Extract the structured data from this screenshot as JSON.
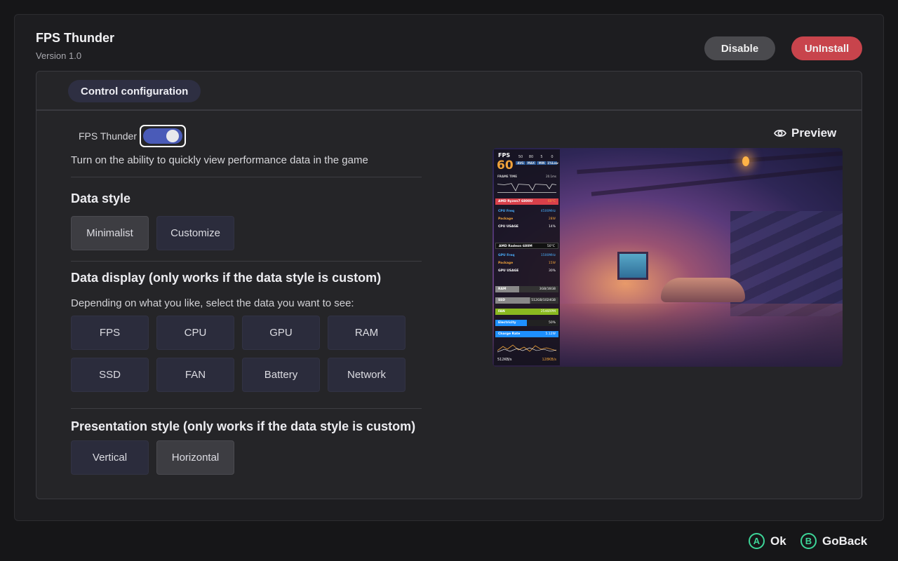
{
  "app": {
    "title": "FPS Thunder",
    "version": "Version 1.0"
  },
  "actions": {
    "disable_label": "Disable",
    "uninstall_label": "UnInstall"
  },
  "tabs": {
    "active_label": "Control configuration"
  },
  "toggle": {
    "label": "FPS Thunder",
    "enabled": true,
    "description": "Turn on the ability to quickly view performance data in the game"
  },
  "data_style": {
    "title": "Data style",
    "options": [
      "Minimalist",
      "Customize"
    ],
    "selected": "Minimalist"
  },
  "data_display": {
    "title": "Data display (only works if the data style is custom)",
    "description": "Depending on what you like, select the data you want to see:",
    "options": [
      "FPS",
      "CPU",
      "GPU",
      "RAM",
      "SSD",
      "FAN",
      "Battery",
      "Network"
    ]
  },
  "presentation_style": {
    "title": "Presentation style (only works if the data style is custom)",
    "options": [
      "Vertical",
      "Horizontal"
    ],
    "selected": "Horizontal"
  },
  "preview": {
    "label": "Preview",
    "hud": {
      "fps_label": "FPS",
      "fps_value": "60",
      "mini_stats": [
        {
          "value": "50",
          "label": "AVG"
        },
        {
          "value": "80",
          "label": "MAX"
        },
        {
          "value": "5",
          "label": "MIN"
        },
        {
          "value": "0",
          "label": "1%Low"
        }
      ],
      "frame_time_label": "FRAME TIME",
      "frame_time_value": "20.1ms",
      "cpu_header": "AMD Ryzen7 6800U",
      "cpu_temp": "60°C",
      "cpu_rows": [
        {
          "label": "CPU Freq",
          "value": "4500MHz"
        },
        {
          "label": "Package",
          "value": "28W"
        },
        {
          "label": "CPU USAGE",
          "value": "14%"
        }
      ],
      "gpu_header": "AMD Radeon 680M",
      "gpu_temp": "50°C",
      "gpu_rows": [
        {
          "label": "GPU Freq",
          "value": "1500MHz"
        },
        {
          "label": "Package",
          "value": "15W"
        },
        {
          "label": "GPU USAGE",
          "value": "30%"
        }
      ],
      "ram": {
        "label": "RAM",
        "value": "3GB/16GB"
      },
      "ssd": {
        "label": "SSD",
        "value": "512GB/1024GB"
      },
      "fan": {
        "label": "FAN",
        "value": "2546RPM"
      },
      "electricity": {
        "label": "Electricity",
        "value": "50%"
      },
      "charge_rate": {
        "label": "Charge Rate",
        "value": "5.12W"
      },
      "net_up": "512KB/s",
      "net_down": "128KB/s"
    }
  },
  "footer": {
    "ok": {
      "glyph": "A",
      "label": "Ok"
    },
    "goback": {
      "glyph": "B",
      "label": "GoBack"
    }
  },
  "colors": {
    "accent_green": "#3dd598",
    "danger": "#c8444c",
    "toggle_on": "#4a5bb8"
  }
}
